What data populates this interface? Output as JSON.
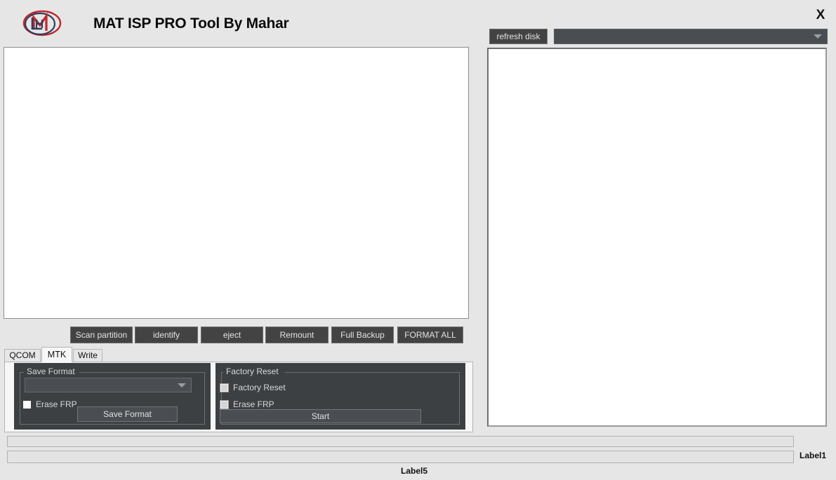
{
  "header": {
    "title": "MAT ISP PRO Tool By Mahar",
    "logo_name": "mat-logo",
    "close_label": "X",
    "logo_colors": {
      "red": "#c0272d",
      "navy": "#2e3d5c"
    }
  },
  "log_panel": {
    "content": ""
  },
  "action_buttons": [
    {
      "id": "scan-partition",
      "label": "Scan partition"
    },
    {
      "id": "identify",
      "label": "identify"
    },
    {
      "id": "eject",
      "label": "eject"
    },
    {
      "id": "remount",
      "label": "Remount"
    },
    {
      "id": "full-backup",
      "label": "Full Backup"
    },
    {
      "id": "format-all",
      "label": "FORMAT ALL"
    }
  ],
  "tabs": [
    {
      "id": "qcom",
      "label": "QCOM",
      "selected": false
    },
    {
      "id": "mtk",
      "label": "MTK",
      "selected": true
    },
    {
      "id": "write",
      "label": "Write",
      "selected": false
    }
  ],
  "save_format_group": {
    "title": "Save Format",
    "combo": {
      "value": "",
      "placeholder": "",
      "arrow_icon": "chevron-down-icon"
    },
    "erase_frp": {
      "label": "Erase FRP",
      "checked": false
    },
    "button": {
      "label": "Save Format"
    }
  },
  "factory_reset_group": {
    "title": "Factory Reset",
    "factory_reset": {
      "label": "Factory Reset",
      "checked": false,
      "disabled": true
    },
    "erase_frp": {
      "label": "Erase FRP",
      "checked": false,
      "disabled": true
    },
    "start_button": {
      "label": "Start"
    }
  },
  "right_panel": {
    "refresh_button": {
      "label": "refresh disk"
    },
    "disk_combo": {
      "value": "",
      "arrow_icon": "chevron-down-icon"
    },
    "disk_list": {
      "items": []
    }
  },
  "status": {
    "progress_1": {
      "value": 0,
      "text": ""
    },
    "progress_2": {
      "value": 0,
      "text": ""
    },
    "label1": "Label1",
    "label5": "Label5"
  },
  "colors": {
    "window_bg": "#e6e6e6",
    "panel_dark": "#3c4043",
    "button_dark": "#434343",
    "text_light": "#e3e3e3"
  }
}
